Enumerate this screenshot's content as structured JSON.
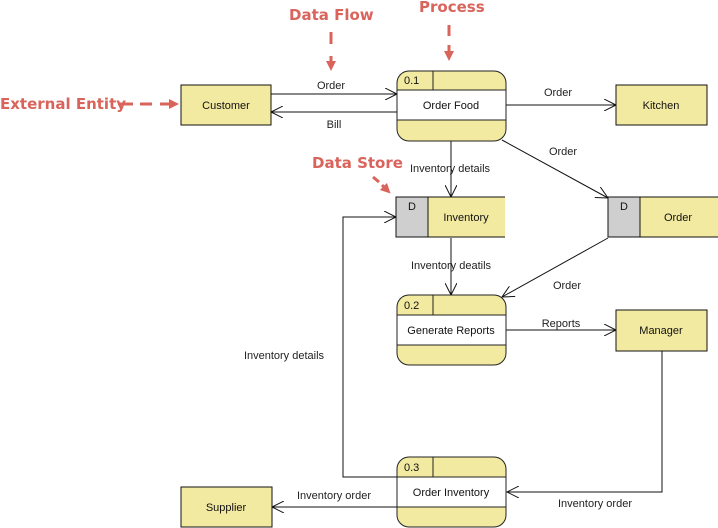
{
  "colors": {
    "entity_fill": "#f3eaa1",
    "store_id_fill": "#cfcfcf",
    "annotation": "#d9645c",
    "line": "#111111"
  },
  "annotations": {
    "data_flow": "Data Flow",
    "process": "Process",
    "external_entity": "External Entity",
    "data_store": "Data Store"
  },
  "entities": {
    "customer": "Customer",
    "kitchen": "Kitchen",
    "manager": "Manager",
    "supplier": "Supplier"
  },
  "processes": [
    {
      "id": "0.1",
      "name": "Order Food"
    },
    {
      "id": "0.2",
      "name": "Generate Reports"
    },
    {
      "id": "0.3",
      "name": "Order Inventory"
    }
  ],
  "stores": [
    {
      "id": "D",
      "name": "Inventory"
    },
    {
      "id": "D",
      "name": "Order"
    }
  ],
  "flows": {
    "customer_to_order_food": "Order",
    "order_food_to_customer": "Bill",
    "order_food_to_kitchen": "Order",
    "order_food_to_order_store": "Order",
    "order_food_to_inventory": "Inventory details",
    "inventory_to_generate_reports": "Inventory deatils",
    "order_store_to_generate_reports": "Order",
    "generate_reports_to_manager": "Reports",
    "order_inventory_to_inventory": "Inventory details",
    "manager_to_order_inventory": "Inventory order",
    "order_inventory_to_supplier": "Inventory order"
  }
}
